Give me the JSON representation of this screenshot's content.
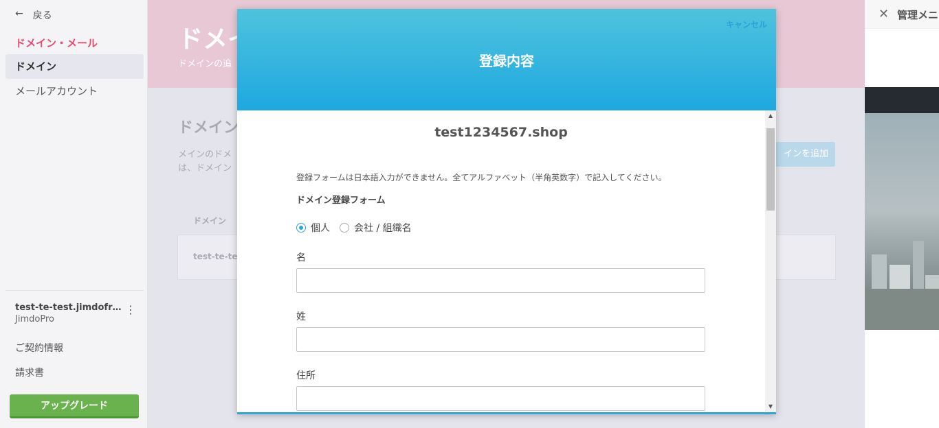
{
  "sidebar": {
    "back_icon": "←",
    "back_label": "戻る",
    "section_title": "ドメイン・メール",
    "items": [
      {
        "label": "ドメイン",
        "active": true
      },
      {
        "label": "メールアカウント",
        "active": false
      }
    ],
    "site_name": "test-te-test.jimdofree.com",
    "site_plan": "JimdoPro",
    "links": [
      "ご契約情報",
      "請求書"
    ],
    "upgrade_label": "アップグレード"
  },
  "background": {
    "hero_title": "ドメイ",
    "hero_sub": "ドメインの追",
    "section_title": "ドメイン",
    "description_line1": "メインのドメ",
    "description_line2": "は、ドメイン",
    "add_button": "インを追加",
    "table_header": "ドメイン",
    "table_cell": "test-te-tes"
  },
  "right_panel": {
    "close_icon": "✕",
    "title": "管理メニ"
  },
  "modal": {
    "cancel_label": "キャンセル",
    "title": "登録内容",
    "domain": "test1234567.shop",
    "notice": "登録フォームは日本語入力ができません。全てアルファベット（半角英数字）で記入してください。",
    "form_title": "ドメイン登録フォーム",
    "radio_options": [
      {
        "label": "個人",
        "checked": true
      },
      {
        "label": "会社 / 組織名",
        "checked": false
      }
    ],
    "fields": [
      {
        "label": "名",
        "value": ""
      },
      {
        "label": "姓",
        "value": ""
      },
      {
        "label": "住所",
        "value": ""
      }
    ]
  },
  "colors": {
    "accent_pink": "#e84b6e",
    "modal_header": "#1ea8e0",
    "upgrade_green": "#69b24d"
  }
}
